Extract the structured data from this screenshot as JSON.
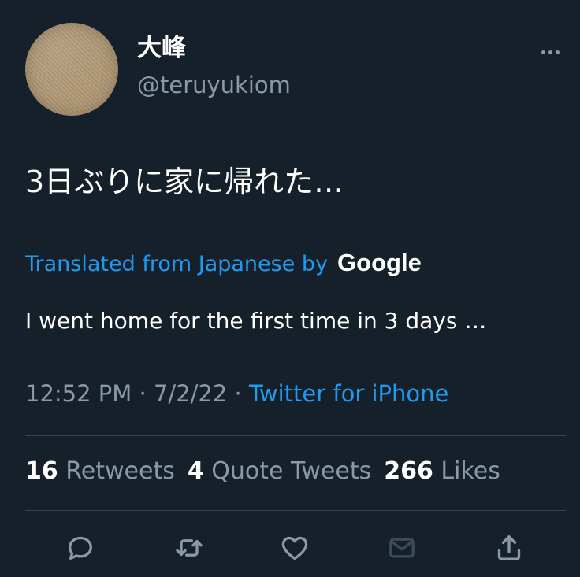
{
  "tweet": {
    "author": {
      "display_name": "大峰",
      "handle": "@teruyukiom"
    },
    "text": "3日ぶりに家に帰れた…",
    "translation": {
      "label": "Translated from Japanese by",
      "provider": "Google",
      "text": "I went home for the first time in 3 days …"
    },
    "meta": {
      "time": "12:52 PM",
      "separator": "·",
      "date": "7/2/22",
      "source": "Twitter for iPhone"
    },
    "stats": {
      "retweets_count": "16",
      "retweets_label": "Retweets",
      "quotes_count": "4",
      "quotes_label": "Quote Tweets",
      "likes_count": "266",
      "likes_label": "Likes"
    },
    "actions": [
      "reply-icon",
      "retweet-icon",
      "like-icon",
      "message-icon",
      "share-icon"
    ]
  },
  "colors": {
    "background": "#15202b",
    "text": "#ffffff",
    "secondary": "#8b98a5",
    "accent": "#1d9bf0",
    "divider": "#38444d"
  }
}
